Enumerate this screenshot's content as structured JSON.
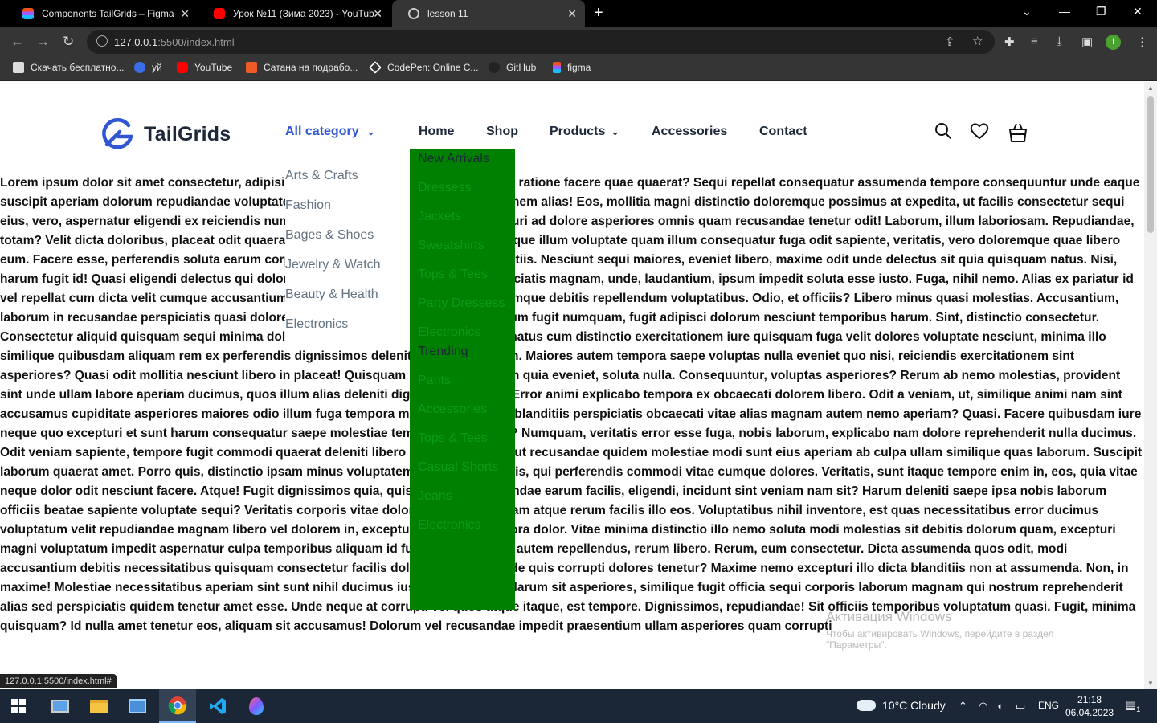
{
  "browser": {
    "tabs": [
      {
        "title": "Components TailGrids – Figma",
        "icon": "figma-icon"
      },
      {
        "title": "Урок №11 (Зима 2023) - YouTube",
        "icon": "youtube-icon"
      },
      {
        "title": "lesson 11",
        "icon": "globe-icon"
      }
    ],
    "url_host": "127.0.0.1",
    "url_path": ":5500/index.html",
    "bookmarks": [
      {
        "label": "Скачать бесплатно...",
        "icon": "download-icon"
      },
      {
        "label": "уй",
        "icon": "shield-icon"
      },
      {
        "label": "YouTube",
        "icon": "youtube-icon"
      },
      {
        "label": "Сатана на подрабо...",
        "icon": "bookmark-icon"
      },
      {
        "label": "CodePen: Online C...",
        "icon": "codepen-icon"
      },
      {
        "label": "GitHub",
        "icon": "github-icon"
      },
      {
        "label": "figma",
        "icon": "figma-icon"
      }
    ],
    "profile_initial": "I",
    "status_url": "127.0.0.1:5500/index.html#"
  },
  "site": {
    "logo_text": "TailGrids",
    "all_category": "All category",
    "nav": {
      "home": "Home",
      "shop": "Shop",
      "products": "Products",
      "accessories": "Accessories",
      "contact": "Contact"
    },
    "categories": [
      "Arts & Crafts",
      "Fashion",
      "Bages & Shoes",
      "Jewelry & Watch",
      "Beauty & Health",
      "Electronics"
    ],
    "dropdown": [
      "New Arrivals",
      "Dressess",
      "Jackets",
      "Sweatshirts",
      "Tops & Tees",
      "Party Dressess",
      "Electronics",
      "Trending",
      "Pants",
      "Accessories",
      "Tops & Tees",
      "Casual Shorts",
      "Jeans",
      "Electronics"
    ],
    "body_text": "Lorem ipsum dolor sit amet consectetur, adipisicing elit. Repellat, sunt quo labore non ratione facere quae quaerat? Sequi repellat consequatur assumenda tempore consequuntur unde eaque suscipit aperiam dolorum repudiandae voluptates, optio obcaecati pariatur exercitationem alias! Eos, mollitia magni distinctio doloremque possimus at expedita, ut facilis consectetur sequi eius, vero, aspernatur eligendi ex reiciendis numquam vitae doloremque fugiat excepturi ad dolore asperiores omnis quam recusandae tenetur odit! Laborum, illum laboriosam. Repudiandae, totam? Velit dicta doloribus, placeat odit quaerat excepturi explicabo maxime doloremque illum voluptate quam illum consequatur fuga odit sapiente, veritatis, vero doloremque quae libero eum. Facere esse, perferendis soluta earum corporis rem! Atque odio molestias blanditiis. Nesciunt sequi maiores, eveniet libero, maxime odit unde delectus sit quia quisquam natus. Nisi, harum fugit id! Quasi eligendi delectus qui dolores accusantium eveniet debitis perspiciatis magnam, unde, laudantium, ipsum impedit soluta esse iusto. Fuga, nihil nemo. Alias ex pariatur id vel repellat cum dicta velit cumque accusantium voluptate. Accusamus vero neque cumque debitis repellendum voluptatibus. Odio, et officiis? Libero minus quasi molestias. Accusantium, laborum in recusandae perspiciatis quasi dolore nisi laboriosam quod praesentium illum fugit numquam, fugit adipisci dolorum nesciunt temporibus harum. Sint, distinctio consectetur. Consectetur aliquid quisquam sequi minima doloribus. Quidem labore libero ipsa illo natus cum distinctio exercitationem iure quisquam fuga velit dolores voluptate nesciunt, minima illo similique quibusdam aliquam rem ex perferendis dignissimos deleniti odio nemo quam. Maiores autem tempora saepe voluptas nulla eveniet quo nisi, reiciendis exercitationem sint asperiores? Quasi odit mollitia nesciunt libero in placeat! Quisquam inventore nostrum quia eveniet, soluta nulla. Consequuntur, voluptas asperiores? Rerum ab nemo molestias, provident sint unde ullam labore aperiam ducimus, quos illum alias deleniti dignissimos omnis. Error animi explicabo tempora ex obcaecati dolorem libero. Odit a veniam, ut, similique animi nam sint accusamus cupiditate asperiores maiores odio illum fuga tempora minima error dicta, blanditiis perspiciatis obcaecati vitae alias magnam autem nemo aperiam? Quasi. Facere quibusdam iure neque quo excepturi et sunt harum consequatur saepe molestiae tempora eum magni? Numquam, veritatis error esse fuga, nobis laborum, explicabo nam dolore reprehenderit nulla ducimus. Odit veniam sapiente, tempore fugit commodi quaerat deleniti libero assumenda quae ut recusandae quidem molestiae modi sunt eius aperiam ab culpa ullam similique quas laborum. Suscipit laborum quaerat amet. Porro quis, distinctio ipsam minus voluptatem dolorum blanditiis, qui perferendis commodi vitae cumque dolores. Veritatis, sunt itaque tempore enim in, eos, quia vitae neque dolor odit nesciunt facere. Atque! Fugit dignissimos quia, quis aliquam repudiandae earum facilis, eligendi, incidunt sint veniam nam sit? Harum deleniti saepe ipsa nobis laborum officiis beatae sapiente voluptate sequi? Veritatis corporis vitae doloremque. Quibusdam atque rerum facilis illo eos. Voluptatibus nihil inventore, est quas necessitatibus error ducimus voluptatum velit repudiandae magnam libero vel dolorem in, excepturi distinctio tempora dolor. Vitae minima distinctio illo nemo soluta modi molestias sit debitis dolorum quam, excepturi magni voluptatum impedit aspernatur culpa temporibus aliquam id fugiat repudiandae autem repellendus, rerum libero. Rerum, eum consectetur. Dicta assumenda quos odit, modi accusantium debitis necessitatibus quisquam consectetur facilis dolorem, impedit unde quis corrupti dolores tenetur? Maxime nemo excepturi illo dicta blanditiis non at assumenda. Non, in maxime! Molestiae necessitatibus aperiam sint sunt nihil ducimus iusto natus quam! Harum sit asperiores, similique fugit officia sequi corporis laborum magnam qui nostrum reprehenderit alias sed perspiciatis quidem tenetur amet esse. Unde neque at corrupti vel quos atque itaque, est tempore. Dignissimos, repudiandae! Sit officiis temporibus voluptatum quasi. Fugit, minima quisquam? Id nulla amet tenetur eos, aliquam sit accusamus! Dolorum vel recusandae impedit praesentium ullam asperiores quam corrupti"
  },
  "watermark": {
    "line1": "Активация Windows",
    "line2": "Чтобы активировать Windows, перейдите в раздел \"Параметры\"."
  },
  "taskbar": {
    "weather": "10°C  Cloudy",
    "lang": "ENG",
    "time": "21:18",
    "date": "06.04.2023",
    "notifications": "1"
  },
  "colors": {
    "brand_blue": "#3056d3",
    "dropdown_green": "#008000"
  }
}
